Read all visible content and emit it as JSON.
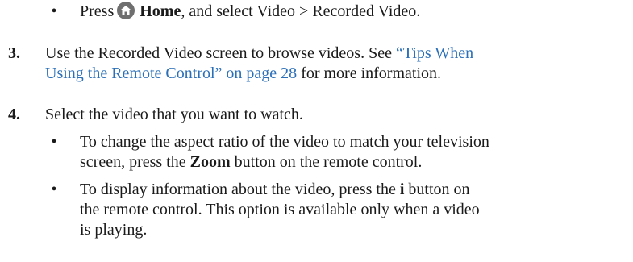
{
  "colors": {
    "text": "#1a1a1a",
    "link": "#2b6fb8",
    "home_icon_bg": "#6f6f6f"
  },
  "bullet_char": "•",
  "line1": {
    "pre": "Press",
    "icon": "home-icon",
    "bold": "Home",
    "post": ", and select Video > Recorded Video."
  },
  "step3": {
    "number": "3.",
    "text_a": "Use the Recorded Video screen to browse videos. See ",
    "link_a": "“Tips When",
    "link_b": "Using the Remote Control” on page 28",
    "text_b": " for more information."
  },
  "step4": {
    "number": "4.",
    "text": "Select the video that you want to watch.",
    "bullets": [
      {
        "l1": "To change the aspect ratio of the video to match your television",
        "l2_pre": "screen, press the ",
        "l2_bold": "Zoom",
        "l2_post": " button on the remote control."
      },
      {
        "l1_pre": "To display information about the video, press the ",
        "l1_bold": "i",
        "l1_post": " button on",
        "l2": "the remote control. This option is available only when a video",
        "l3": "is playing."
      }
    ]
  }
}
